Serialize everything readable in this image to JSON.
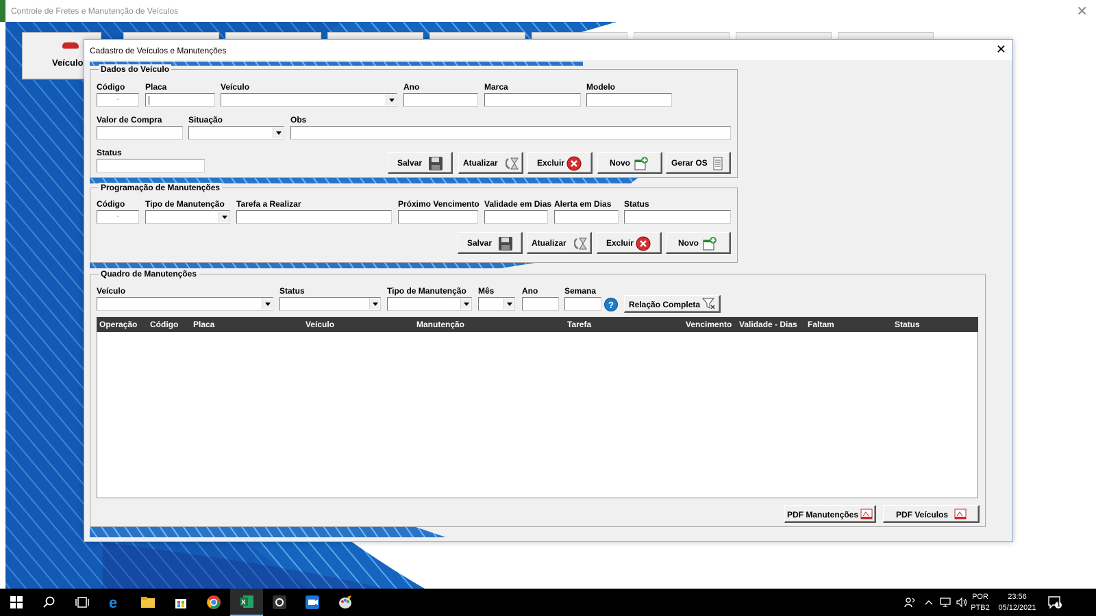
{
  "app": {
    "title": "Controle de Fretes e Manutenção de Veículos",
    "close_glyph": "✕",
    "first_tab_label": "Veículos"
  },
  "dialog": {
    "title": "Cadastro de Veículos e Manutenções",
    "close_glyph": "✕"
  },
  "dados": {
    "group_title": "Dados do Veículo",
    "labels": {
      "codigo": "Código",
      "placa": "Placa",
      "veiculo": "Veículo",
      "ano": "Ano",
      "marca": "Marca",
      "modelo": "Modelo",
      "valor": "Valor de Compra",
      "situacao": "Situação",
      "obs": "Obs",
      "status": "Status"
    },
    "values": {
      "codigo": "-",
      "placa": "",
      "veiculo": "",
      "ano": "",
      "marca": "",
      "modelo": "",
      "valor": "",
      "situacao": "",
      "obs": "",
      "status": ""
    },
    "buttons": {
      "salvar": "Salvar",
      "atualizar": "Atualizar",
      "excluir": "Excluir",
      "novo": "Novo",
      "gerar_os": "Gerar OS"
    }
  },
  "programacao": {
    "group_title": "Programação de Manutenções",
    "labels": {
      "codigo": "Código",
      "tipo": "Tipo de Manutenção",
      "tarefa": "Tarefa a Realizar",
      "proximo": "Próximo Vencimento",
      "validade": "Validade em Dias",
      "alerta": "Alerta em Dias",
      "status": "Status"
    },
    "values": {
      "codigo": "-"
    },
    "buttons": {
      "salvar": "Salvar",
      "atualizar": "Atualizar",
      "excluir": "Excluir",
      "novo": "Novo"
    }
  },
  "quadro": {
    "group_title": "Quadro de Manutenções",
    "filters": {
      "veiculo": "Veículo",
      "status": "Status",
      "tipo": "Tipo de Manutenção",
      "mes": "Mês",
      "ano": "Ano",
      "semana": "Semana"
    },
    "help_glyph": "?",
    "relacao_button": "Relação Completa",
    "columns": [
      "Operação",
      "Código",
      "Placa",
      "Veículo",
      "Manutenção",
      "Tarefa",
      "Vencimento",
      "Validade - Dias",
      "Faltam",
      "Status"
    ],
    "rows": [],
    "pdf_manutencoes": "PDF Manutenções",
    "pdf_veiculos": "PDF Veículos"
  },
  "taskbar": {
    "items": [
      "windows-start",
      "search",
      "task-view",
      "edge",
      "file-explorer",
      "store",
      "chrome",
      "excel",
      "app-camera",
      "app-meet",
      "paint"
    ],
    "language": "POR",
    "layout": "PTB2",
    "time": "23:56",
    "date": "05/12/2021",
    "notification_count": "1"
  },
  "colors": {
    "grid_header": "#3a3a3a",
    "excel_green": "#1d6f42",
    "accent_blue": "#1e7cc8",
    "delete_red": "#d32f2f"
  }
}
